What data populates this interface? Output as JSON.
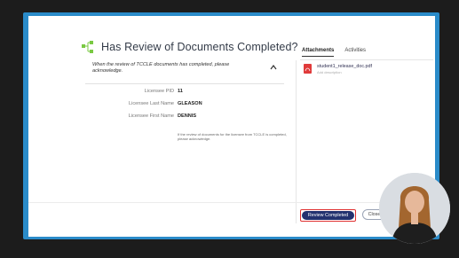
{
  "modal": {
    "title": "Has Review of Documents Completed?",
    "acknowledge_text": "When the review of TCCLE documents has completed, please acknowledge.",
    "fields": [
      {
        "label": "Licensee PID",
        "value": "11"
      },
      {
        "label": "Licensee Last Name",
        "value": "GLEASON"
      },
      {
        "label": "Licensee First Name",
        "value": "DENNIS"
      }
    ],
    "note": "If the review of documents for the licensee from TCCLE is completed, please acknowledge."
  },
  "side": {
    "tabs": [
      {
        "label": "Attachments",
        "active": true
      },
      {
        "label": "Activities",
        "active": false
      }
    ],
    "attachment": {
      "name": "student1_release_doc.pdf",
      "subtitle": "Add description"
    }
  },
  "buttons": {
    "primary": "Review Completed",
    "secondary": "Close"
  },
  "colors": {
    "frame": "#2a8bc9",
    "primary_button": "#23316f",
    "highlight": "#e03131",
    "pdf_icon": "#e03a3a"
  },
  "icons": [
    "task-icon",
    "chevron-up-icon",
    "pdf-icon"
  ]
}
